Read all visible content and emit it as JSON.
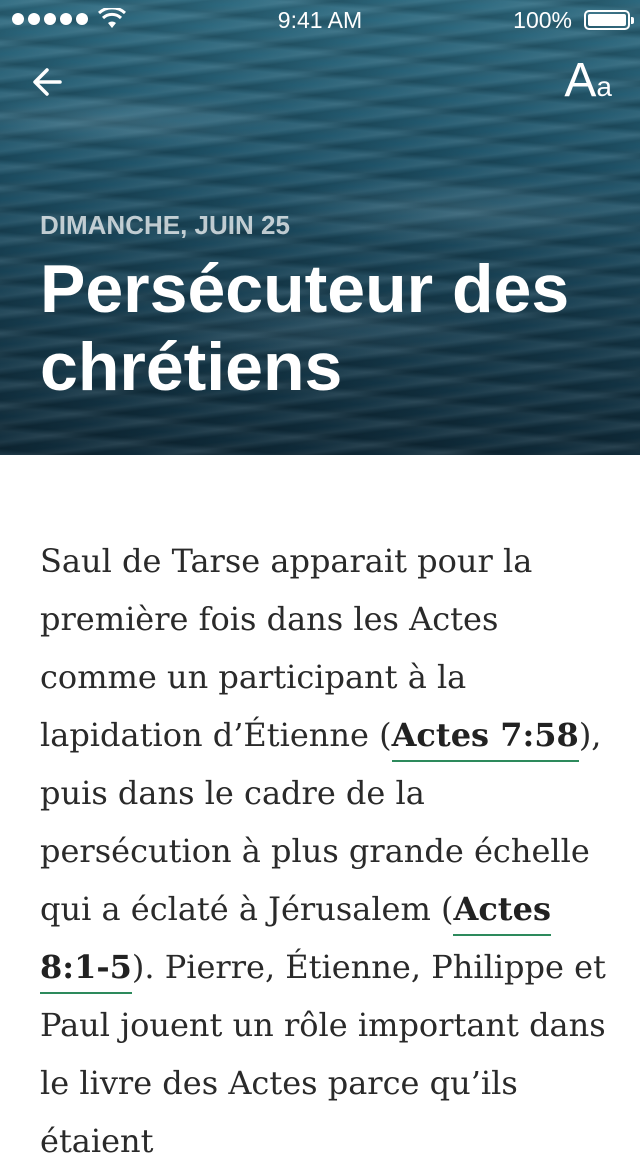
{
  "status_bar": {
    "time": "9:41 AM",
    "battery": "100%"
  },
  "header": {
    "back_icon": "arrow-left-icon",
    "font_size_label_big": "A",
    "font_size_label_small": "a",
    "date": "DIMANCHE, JUIN 25",
    "title": "Persécuteur des chrétiens"
  },
  "body": {
    "segments": {
      "s1": "Saul de Tarse apparait pour la première fois dans les Actes comme un participant à la lapidation d’Étienne (",
      "ref1": "Actes 7:58",
      "s2": "), puis dans le cadre de la persécution à plus grande échelle qui a éclaté à Jérusalem (",
      "ref2": "Actes 8:1-5",
      "s3": "). Pierre, Étienne, Philippe et Paul jouent un rôle important dans le livre des Actes parce qu’ils étaient"
    }
  },
  "colors": {
    "accent_underline": "#2d8a5c",
    "text": "#2a2a2a"
  }
}
